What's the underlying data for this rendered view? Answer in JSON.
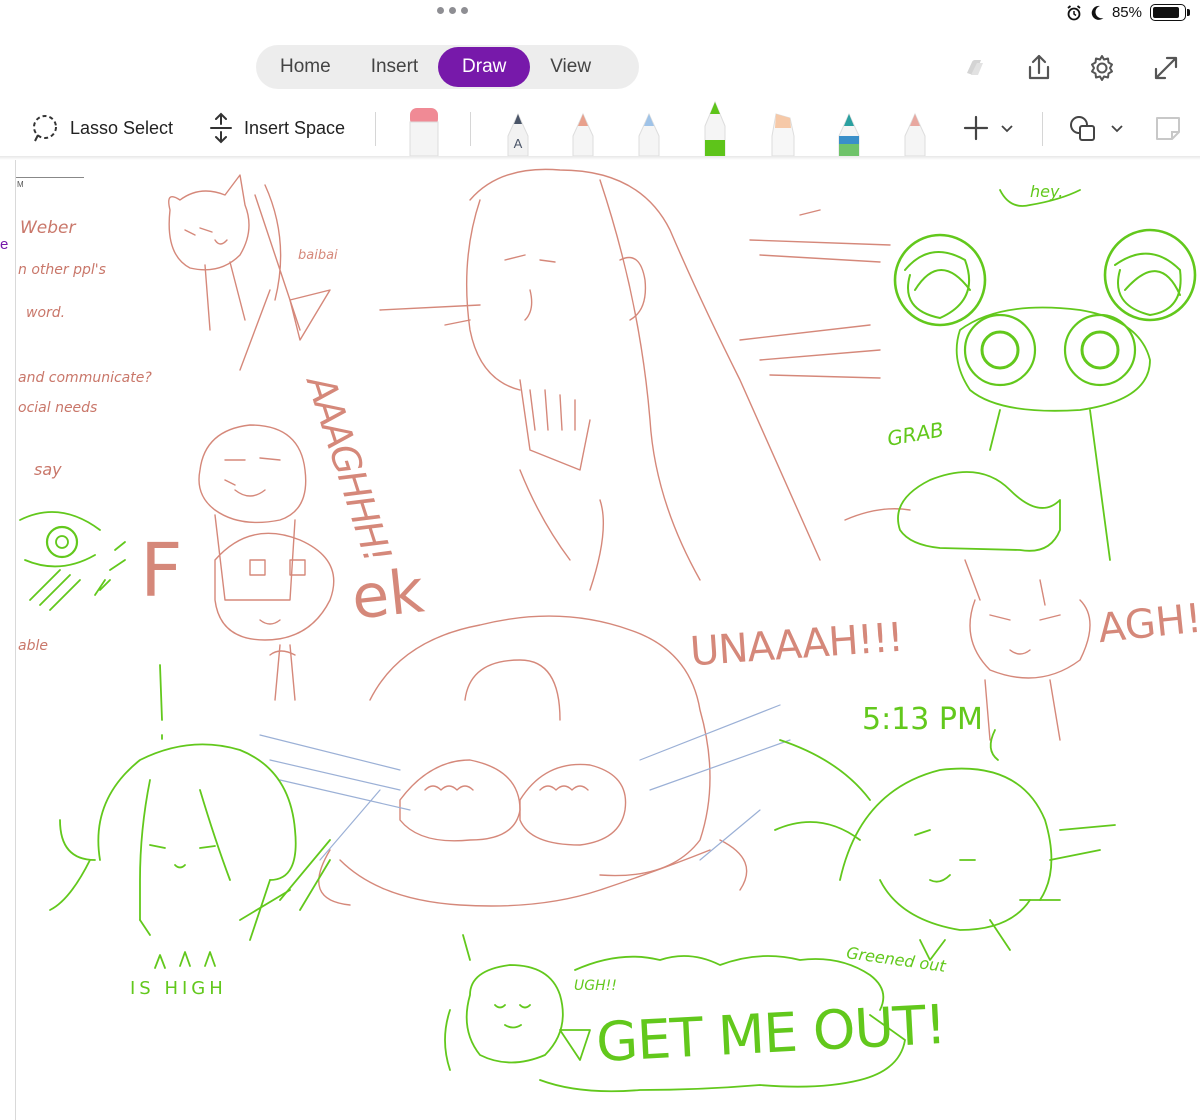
{
  "status_bar": {
    "battery_percent": "85%",
    "battery_level": 0.85,
    "alarm_icon": "alarm-icon",
    "moon_icon": "do-not-disturb-icon"
  },
  "tabs": [
    {
      "label": "Home"
    },
    {
      "label": "Insert"
    },
    {
      "label": "Draw",
      "active": true
    },
    {
      "label": "View"
    }
  ],
  "top_icons": [
    "copilot-icon",
    "share-icon",
    "settings-gear-icon",
    "expand-icon"
  ],
  "toolbar": {
    "lasso_label": "Lasso Select",
    "insert_space_label": "Insert Space",
    "pens": [
      {
        "name": "eraser",
        "color": "#f08a95"
      },
      {
        "name": "text-pen",
        "color": "#4a5568"
      },
      {
        "name": "pencil-salmon",
        "color": "#e8a08c"
      },
      {
        "name": "pencil-blue",
        "color": "#9fc3e8"
      },
      {
        "name": "pen-green",
        "color": "#5ec41a"
      },
      {
        "name": "highlighter-peach",
        "color": "#f6c9a8"
      },
      {
        "name": "pen-galaxy",
        "color": "#2aa0a0"
      },
      {
        "name": "pencil-pink",
        "color": "#e8a8a0"
      }
    ]
  },
  "colors": {
    "accent": "#7719aa",
    "ink_green": "#62c81c",
    "ink_salmon": "#d5887a",
    "ink_blue": "#9bb0d6"
  },
  "page": {
    "notes": [
      "Weber",
      "n other ppl's",
      "word.",
      "and communicate?",
      "ocial needs",
      "say",
      "able"
    ],
    "sketch_text": {
      "baibai": "baibai",
      "scream": "AAAGHHH!",
      "hey": "hey.",
      "grab": "GRAB",
      "f": "F",
      "ek": "ek",
      "unaaah": "UNAAAH!!!",
      "agh": "AGH!!",
      "time": "5:13 PM",
      "is_high": "IS HIGH",
      "greened_out": "Greened out",
      "ugh": "UGH!!",
      "get_me_out": "GET ME OUT!"
    }
  }
}
